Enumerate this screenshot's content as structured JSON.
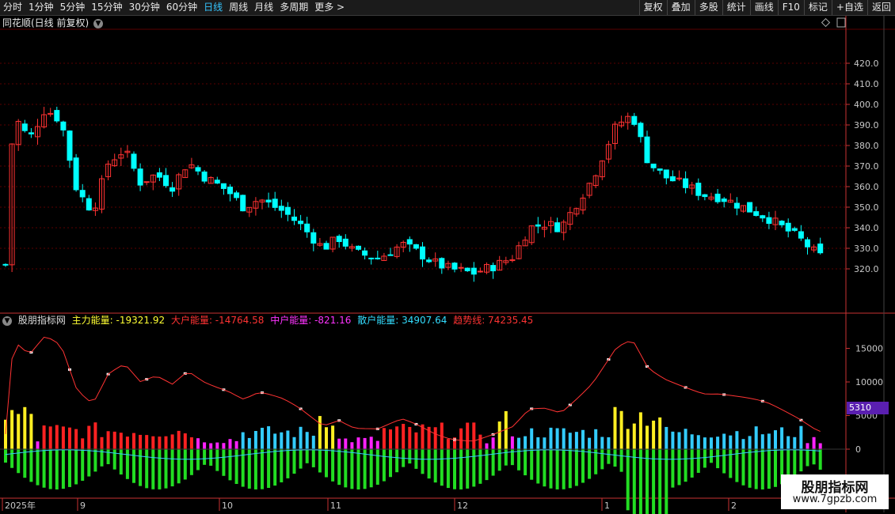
{
  "toolbar": {
    "timeframes": [
      "分时",
      "1分钟",
      "5分钟",
      "15分钟",
      "30分钟",
      "60分钟",
      "日线",
      "周线",
      "月线",
      "多周期",
      "更多 >"
    ],
    "active_index": 6,
    "right_buttons": [
      "复权",
      "叠加",
      "多股",
      "统计",
      "画线",
      "F10",
      "标记",
      "+自选",
      "返回"
    ]
  },
  "main_chart": {
    "title": "同花顺(日线 前复权)",
    "price_labels": [
      "420.0",
      "410.0",
      "400.0",
      "390.0",
      "380.0",
      "370.0",
      "360.0",
      "350.0",
      "340.0",
      "330.0",
      "320.0"
    ]
  },
  "indicator": {
    "name": "股朋指标网",
    "fields": [
      {
        "label": "主力能量: -19321.92",
        "color": "#ffff33"
      },
      {
        "label": "大户能量: -14764.58",
        "color": "#ff3333"
      },
      {
        "label": "中户能量: -821.16",
        "color": "#ff33ff"
      },
      {
        "label": "散户能量: 34907.64",
        "color": "#33ddff"
      },
      {
        "label": "趋势线: 74235.45",
        "color": "#ff3333"
      }
    ],
    "axis_labels": [
      "15000",
      "10000",
      "5000",
      "0"
    ],
    "cursor_value": "5310"
  },
  "x_axis": {
    "labels": [
      "2025年",
      "9",
      "10",
      "11",
      "12",
      "1",
      "2"
    ]
  },
  "watermark": {
    "title": "股朋指标网",
    "url": "www.7gpzb.com"
  },
  "colors": {
    "up": "#ff3232",
    "down": "#00ffff",
    "grid": "#5a0000",
    "axis": "#c83232"
  }
}
